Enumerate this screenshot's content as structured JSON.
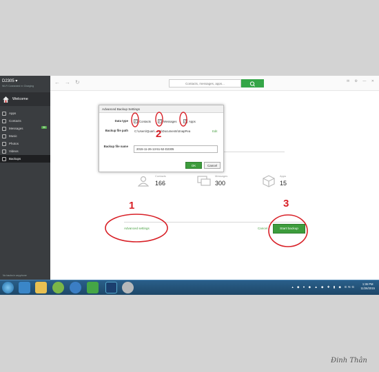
{
  "sidebar": {
    "device": "D2305 ▾",
    "device_sub": "Wi-Fi Connected  ▪▪▪ Charging",
    "welcome": "Welcome",
    "items": [
      {
        "label": "Apps",
        "icon": "apps-icon"
      },
      {
        "label": "Contacts",
        "icon": "contacts-icon"
      },
      {
        "label": "Messages",
        "icon": "messages-icon",
        "badge": "30"
      },
      {
        "label": "Music",
        "icon": "music-icon"
      },
      {
        "label": "Photos",
        "icon": "photos-icon"
      },
      {
        "label": "Videos",
        "icon": "videos-icon"
      },
      {
        "label": "Backups",
        "icon": "backups-icon",
        "active": true
      }
    ],
    "footer": "No backs in anyphone"
  },
  "topbar": {
    "search_placeholder": "Contacts, messages, apps..."
  },
  "dialog": {
    "title": "Advanced Backup Settings",
    "data_type_label": "Data type",
    "options": [
      "Contacts",
      "Messages",
      "Apps"
    ],
    "path_label": "Backup file path",
    "path_value": "C:\\Users\\Quan\\...ren\\Documents\\SnapPea",
    "edit": "Edit",
    "name_label": "Backup file name",
    "name_value": "2015-11-26-13-51-52-D2305",
    "ok": "OK",
    "cancel": "Cancel"
  },
  "stats": [
    {
      "label": "Contacts",
      "value": "166"
    },
    {
      "label": "Messages",
      "value": "300"
    },
    {
      "label": "Apps",
      "value": "15"
    }
  ],
  "actions": {
    "advanced": "Advanced settings",
    "cancel": "Cancel",
    "start": "Start backup"
  },
  "taskbar": {
    "lang": "ENG",
    "time": "1:36 PM",
    "date": "11/26/2015"
  },
  "annotations": [
    "1",
    "2",
    "3"
  ],
  "annotation_color": "#d81f26",
  "signature": "Đinh Thân"
}
